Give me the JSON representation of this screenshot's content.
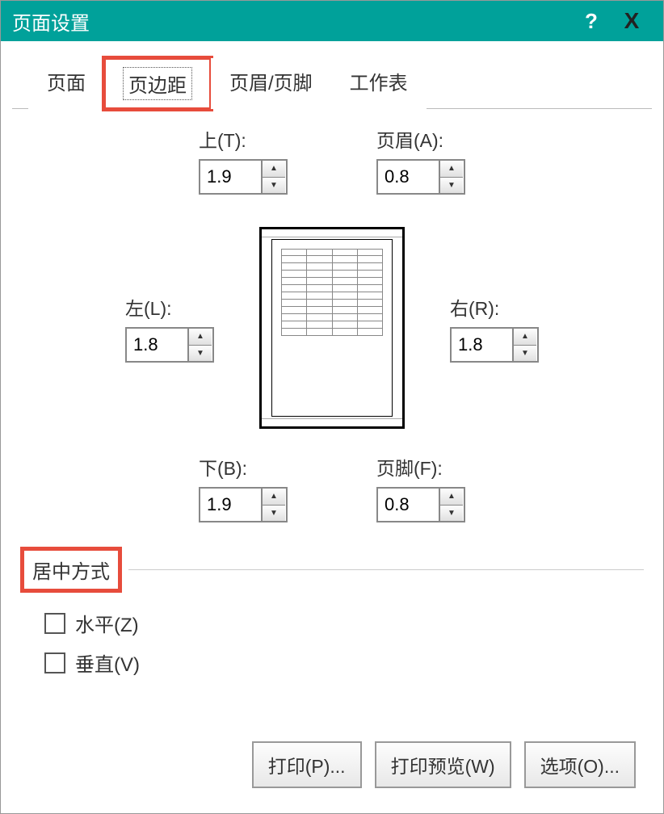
{
  "titlebar": {
    "title": "页面设置",
    "help": "?",
    "close": "X"
  },
  "tabs": {
    "page": "页面",
    "margins": "页边距",
    "header_footer": "页眉/页脚",
    "sheet": "工作表"
  },
  "margins": {
    "top": {
      "label": "上(T):",
      "value": "1.9"
    },
    "header": {
      "label": "页眉(A):",
      "value": "0.8"
    },
    "left": {
      "label": "左(L):",
      "value": "1.8"
    },
    "right": {
      "label": "右(R):",
      "value": "1.8"
    },
    "bottom": {
      "label": "下(B):",
      "value": "1.9"
    },
    "footer": {
      "label": "页脚(F):",
      "value": "0.8"
    }
  },
  "center_section": {
    "title": "居中方式",
    "horizontal": "水平(Z)",
    "vertical": "垂直(V)"
  },
  "buttons": {
    "print": "打印(P)...",
    "preview": "打印预览(W)",
    "options": "选项(O)..."
  }
}
